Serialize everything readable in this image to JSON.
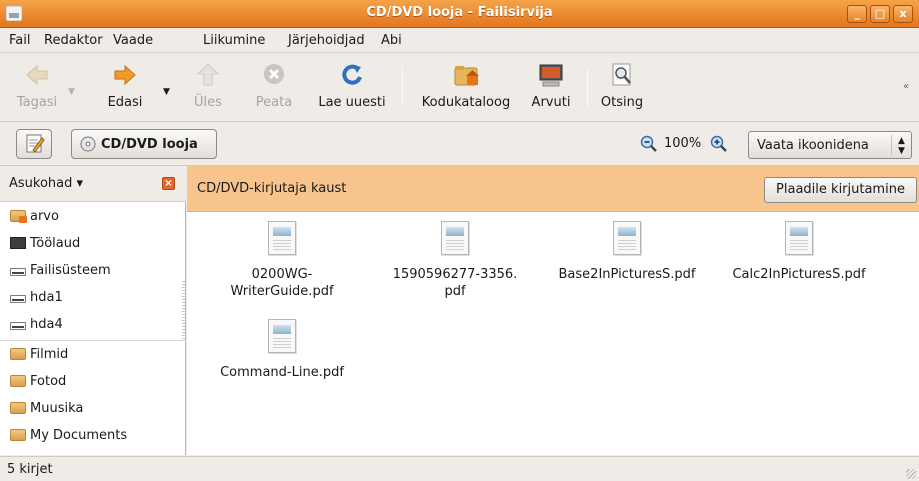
{
  "window": {
    "title": "CD/DVD looja - Failisirvija"
  },
  "menubar": [
    "Fail",
    "Redaktor",
    "Vaade",
    "Liikumine",
    "Järjehoidjad",
    "Abi"
  ],
  "toolbar": {
    "back": "Tagasi",
    "forward": "Edasi",
    "up": "Üles",
    "stop": "Peata",
    "reload": "Lae uuesti",
    "home": "Kodukataloog",
    "computer": "Arvuti",
    "search": "Otsing"
  },
  "location": {
    "current": "CD/DVD looja",
    "zoom": "100%",
    "view_mode": "Vaata ikoonidena"
  },
  "sidebar": {
    "header": "Asukohad",
    "places": [
      "arvo",
      "Töölaud",
      "Failisüsteem",
      "hda1",
      "hda4"
    ],
    "bookmarks": [
      "Filmid",
      "Fotod",
      "Muusika",
      "My Documents"
    ]
  },
  "banner": {
    "text": "CD/DVD-kirjutaja kaust",
    "button": "Plaadile kirjutamine"
  },
  "files": [
    {
      "line1": "0200WG-",
      "line2": "WriterGuide.pdf"
    },
    {
      "line1": "1590596277-3356.",
      "line2": "pdf"
    },
    {
      "line1": "Base2InPicturesS.pdf",
      "line2": ""
    },
    {
      "line1": "Calc2InPicturesS.pdf",
      "line2": ""
    },
    {
      "line1": "Command-Line.pdf",
      "line2": ""
    }
  ],
  "status": {
    "text": "5 kirjet"
  },
  "colors": {
    "titlebar": "#e8822c",
    "banner": "#f7c48e",
    "accent": "#f08c2a"
  }
}
